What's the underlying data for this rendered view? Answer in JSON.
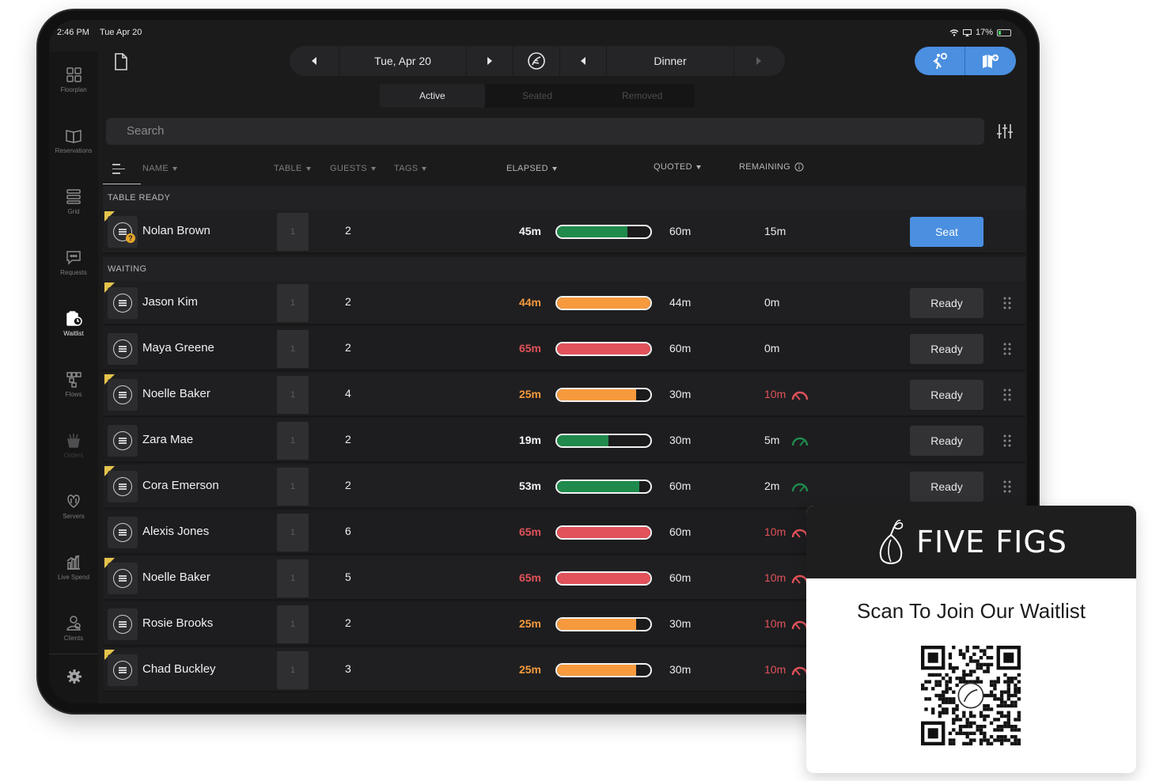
{
  "status": {
    "time": "2:46 PM",
    "date": "Tue Apr 20",
    "battery": "17%"
  },
  "sidebar": {
    "items": [
      {
        "label": "Floorplan",
        "icon": "floorplan-icon"
      },
      {
        "label": "Reservations",
        "icon": "book-icon"
      },
      {
        "label": "Grid",
        "icon": "grid-icon"
      },
      {
        "label": "Requests",
        "icon": "chat-icon"
      },
      {
        "label": "Waitlist",
        "icon": "waitlist-icon",
        "active": true
      },
      {
        "label": "Flows",
        "icon": "flows-icon"
      },
      {
        "label": "Orders",
        "icon": "orders-icon"
      },
      {
        "label": "Servers",
        "icon": "servers-icon"
      },
      {
        "label": "Live Spend",
        "icon": "chart-icon"
      },
      {
        "label": "Clients",
        "icon": "clients-icon"
      }
    ],
    "settings_icon": "gear-icon"
  },
  "topbar": {
    "date": "Tue, Apr 20",
    "service": "Dinner"
  },
  "tabs": [
    "Active",
    "Seated",
    "Removed"
  ],
  "search": {
    "placeholder": "Search"
  },
  "columns": {
    "name": "NAME",
    "table": "TABLE",
    "guests": "GUESTS",
    "tags": "TAGS",
    "elapsed": "ELAPSED",
    "quoted": "QUOTED",
    "remaining": "REMAINING"
  },
  "sections": {
    "ready": "TABLE READY",
    "waiting": "WAITING"
  },
  "colors": {
    "green": "#1f8a4c",
    "orange": "#f69a3d",
    "red": "#e1525a",
    "blue": "#4a8fe0",
    "flag": "#e4c34b"
  },
  "ready_rows": [
    {
      "name": "Nolan Brown",
      "table": "1",
      "guests": "2",
      "elapsed": "45m",
      "quoted": "60m",
      "remaining": "15m",
      "progress": 0.75,
      "status": "green",
      "action": "Seat",
      "flag": true
    }
  ],
  "waiting_rows": [
    {
      "name": "Jason Kim",
      "table": "1",
      "guests": "2",
      "elapsed": "44m",
      "quoted": "44m",
      "remaining": "0m",
      "progress": 1.0,
      "status": "orange",
      "action": "Ready",
      "flag": true,
      "gauge": ""
    },
    {
      "name": "Maya Greene",
      "table": "1",
      "guests": "2",
      "elapsed": "65m",
      "quoted": "60m",
      "remaining": "0m",
      "progress": 1.0,
      "status": "red",
      "action": "Ready",
      "flag": false,
      "gauge": ""
    },
    {
      "name": "Noelle Baker",
      "table": "1",
      "guests": "4",
      "elapsed": "25m",
      "quoted": "30m",
      "remaining": "10m",
      "progress": 0.85,
      "status": "orange",
      "action": "Ready",
      "flag": true,
      "gauge": "red"
    },
    {
      "name": "Zara Mae",
      "table": "1",
      "guests": "2",
      "elapsed": "19m",
      "quoted": "30m",
      "remaining": "5m",
      "progress": 0.55,
      "status": "green",
      "action": "Ready",
      "flag": false,
      "gauge": "green"
    },
    {
      "name": "Cora Emerson",
      "table": "1",
      "guests": "2",
      "elapsed": "53m",
      "quoted": "60m",
      "remaining": "2m",
      "progress": 0.88,
      "status": "green",
      "action": "Ready",
      "flag": true,
      "gauge": "green"
    },
    {
      "name": "Alexis Jones",
      "table": "1",
      "guests": "6",
      "elapsed": "65m",
      "quoted": "60m",
      "remaining": "10m",
      "progress": 1.0,
      "status": "red",
      "action": "",
      "flag": false,
      "gauge": "red"
    },
    {
      "name": "Noelle Baker",
      "table": "1",
      "guests": "5",
      "elapsed": "65m",
      "quoted": "60m",
      "remaining": "10m",
      "progress": 1.0,
      "status": "red",
      "action": "",
      "flag": true,
      "gauge": "red"
    },
    {
      "name": "Rosie Brooks",
      "table": "1",
      "guests": "2",
      "elapsed": "25m",
      "quoted": "30m",
      "remaining": "10m",
      "progress": 0.85,
      "status": "orange",
      "action": "",
      "flag": false,
      "gauge": "red"
    },
    {
      "name": "Chad Buckley",
      "table": "1",
      "guests": "3",
      "elapsed": "25m",
      "quoted": "30m",
      "remaining": "10m",
      "progress": 0.85,
      "status": "orange",
      "action": "",
      "flag": true,
      "gauge": "red"
    }
  ],
  "card": {
    "brand": "FIVE FIGS",
    "title": "Scan To Join Our Waitlist"
  }
}
